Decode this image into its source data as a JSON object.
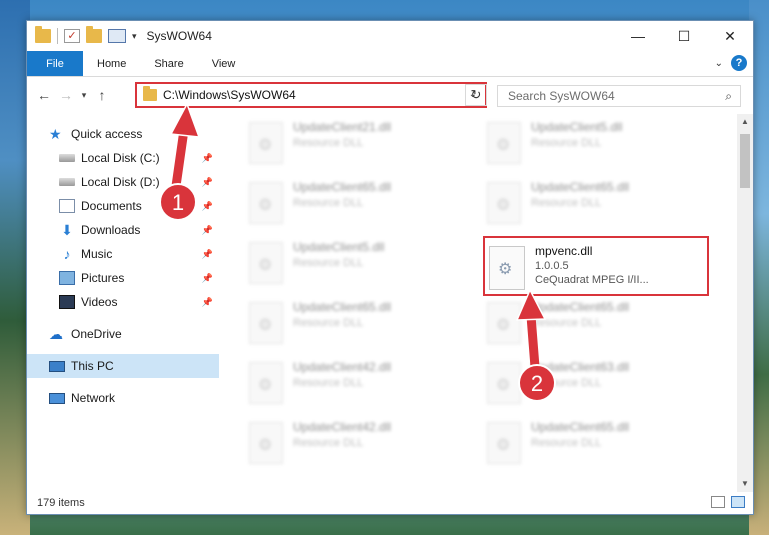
{
  "window": {
    "title": "SysWOW64"
  },
  "ribbon": {
    "tabs": [
      {
        "label": "File"
      },
      {
        "label": "Home"
      },
      {
        "label": "Share"
      },
      {
        "label": "View"
      }
    ],
    "help": "?"
  },
  "navbar": {
    "address": "C:\\Windows\\SysWOW64",
    "search_placeholder": "Search SysWOW64"
  },
  "sidebar": {
    "items": [
      {
        "label": "Quick access",
        "icon": "star-icon"
      },
      {
        "label": "Local Disk (C:)",
        "icon": "disk-icon"
      },
      {
        "label": "Local Disk (D:)",
        "icon": "disk-icon"
      },
      {
        "label": "Documents",
        "icon": "documents-icon"
      },
      {
        "label": "Downloads",
        "icon": "downloads-icon"
      },
      {
        "label": "Music",
        "icon": "music-icon"
      },
      {
        "label": "Pictures",
        "icon": "pictures-icon"
      },
      {
        "label": "Videos",
        "icon": "videos-icon"
      },
      {
        "label": "OneDrive",
        "icon": "onedrive-icon"
      },
      {
        "label": "This PC",
        "icon": "this-pc-icon"
      },
      {
        "label": "Network",
        "icon": "network-icon"
      }
    ]
  },
  "files": {
    "blurred": [
      {
        "name": "UpdateClient21.dll",
        "desc": "Resource DLL"
      },
      {
        "name": "UpdateClient5.dll",
        "desc": "Resource DLL"
      },
      {
        "name": "UpdateClient65.dll",
        "desc": "Resource DLL"
      },
      {
        "name": "UpdateClient65.dll",
        "desc": "Resource DLL"
      },
      {
        "name": "UpdateClient5.dll",
        "desc": "Resource DLL"
      },
      {
        "name": "UpdateClient65.dll",
        "desc": "Resource DLL"
      },
      {
        "name": "UpdateClient65.dll",
        "desc": "Resource DLL"
      },
      {
        "name": "UpdateClient42.dll",
        "desc": "Resource DLL"
      },
      {
        "name": "UpdateClient63.dll",
        "desc": "Resource DLL"
      },
      {
        "name": "UpdateClient42.dll",
        "desc": "Resource DLL"
      },
      {
        "name": "UpdateClient65.dll",
        "desc": "Resource DLL"
      }
    ],
    "highlighted": {
      "name": "mpvenc.dll",
      "version": "1.0.0.5",
      "desc": "CeQuadrat MPEG I/II..."
    }
  },
  "status": {
    "count": "179 items"
  },
  "annotations": {
    "badge1": "1",
    "badge2": "2",
    "color": "#d9343b"
  }
}
